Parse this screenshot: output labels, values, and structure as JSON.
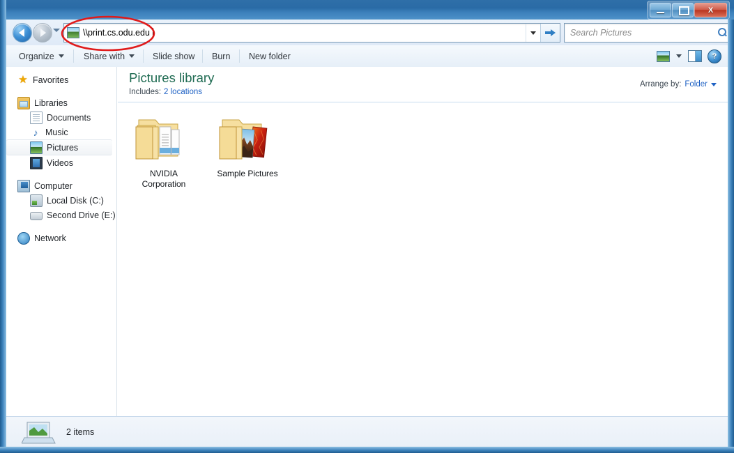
{
  "background_window": {
    "title": "(blurred inactive window)",
    "icon": "paperclip-icon",
    "minimize_label": "",
    "maximize_label": "",
    "close_label": ""
  },
  "window": {
    "title": "",
    "controls": {
      "minimize": "Minimize",
      "maximize": "Maximize",
      "close": "X"
    }
  },
  "navigation": {
    "back_label": "Back",
    "forward_label": "Forward",
    "recent_pages_label": "Recent pages",
    "address": {
      "value": "\\\\print.cs.odu.edu",
      "icon": "pictures-library-icon",
      "dropdown_label": "Previous locations",
      "go_label": "Go"
    },
    "search": {
      "placeholder": "Search Pictures",
      "icon": "search-icon"
    }
  },
  "toolbar": {
    "items": [
      {
        "label": "Organize",
        "has_caret": true
      },
      {
        "label": "Share with",
        "has_caret": true
      },
      {
        "label": "Slide show",
        "has_caret": false
      },
      {
        "label": "Burn",
        "has_caret": false
      },
      {
        "label": "New folder",
        "has_caret": false
      }
    ],
    "right": {
      "view_label": "Change your view",
      "view_caret_label": "More options",
      "preview_pane_label": "Show the preview pane",
      "help_label": "?"
    }
  },
  "sidebar": {
    "items": [
      {
        "label": "Favorites",
        "icon": "star-icon",
        "level": 0,
        "selected": false
      },
      {
        "label": "Libraries",
        "icon": "libraries-icon",
        "level": 0,
        "selected": false
      },
      {
        "label": "Documents",
        "icon": "documents-icon",
        "level": 1,
        "selected": false
      },
      {
        "label": "Music",
        "icon": "music-icon",
        "level": 1,
        "selected": false
      },
      {
        "label": "Pictures",
        "icon": "pictures-icon",
        "level": 1,
        "selected": true
      },
      {
        "label": "Videos",
        "icon": "videos-icon",
        "level": 1,
        "selected": false
      },
      {
        "label": "Computer",
        "icon": "computer-icon",
        "level": 0,
        "selected": false
      },
      {
        "label": "Local Disk (C:)",
        "icon": "local-disk-icon",
        "level": 1,
        "selected": false
      },
      {
        "label": "Second Drive (E:)",
        "icon": "drive-icon",
        "level": 1,
        "selected": false
      },
      {
        "label": "Network",
        "icon": "network-icon",
        "level": 0,
        "selected": false
      }
    ]
  },
  "content": {
    "library_title": "Pictures library",
    "includes_label": "Includes:",
    "includes_link": "2 locations",
    "arrange_label": "Arrange by:",
    "arrange_value": "Folder",
    "items": [
      {
        "name": "NVIDIA Corporation",
        "type": "documents-folder"
      },
      {
        "name": "Sample Pictures",
        "type": "pictures-folder"
      }
    ]
  },
  "status": {
    "text": "2 items",
    "icon": "library-monitor-icon"
  },
  "annotation": {
    "shape": "ellipse",
    "color": "#e01b1b",
    "target": "address-bar"
  },
  "colors": {
    "accent_blue": "#1f62c4",
    "library_title_green": "#1f6b52",
    "annotation_red": "#e01b1b",
    "titlebar_blue": "#2a6ba6"
  }
}
